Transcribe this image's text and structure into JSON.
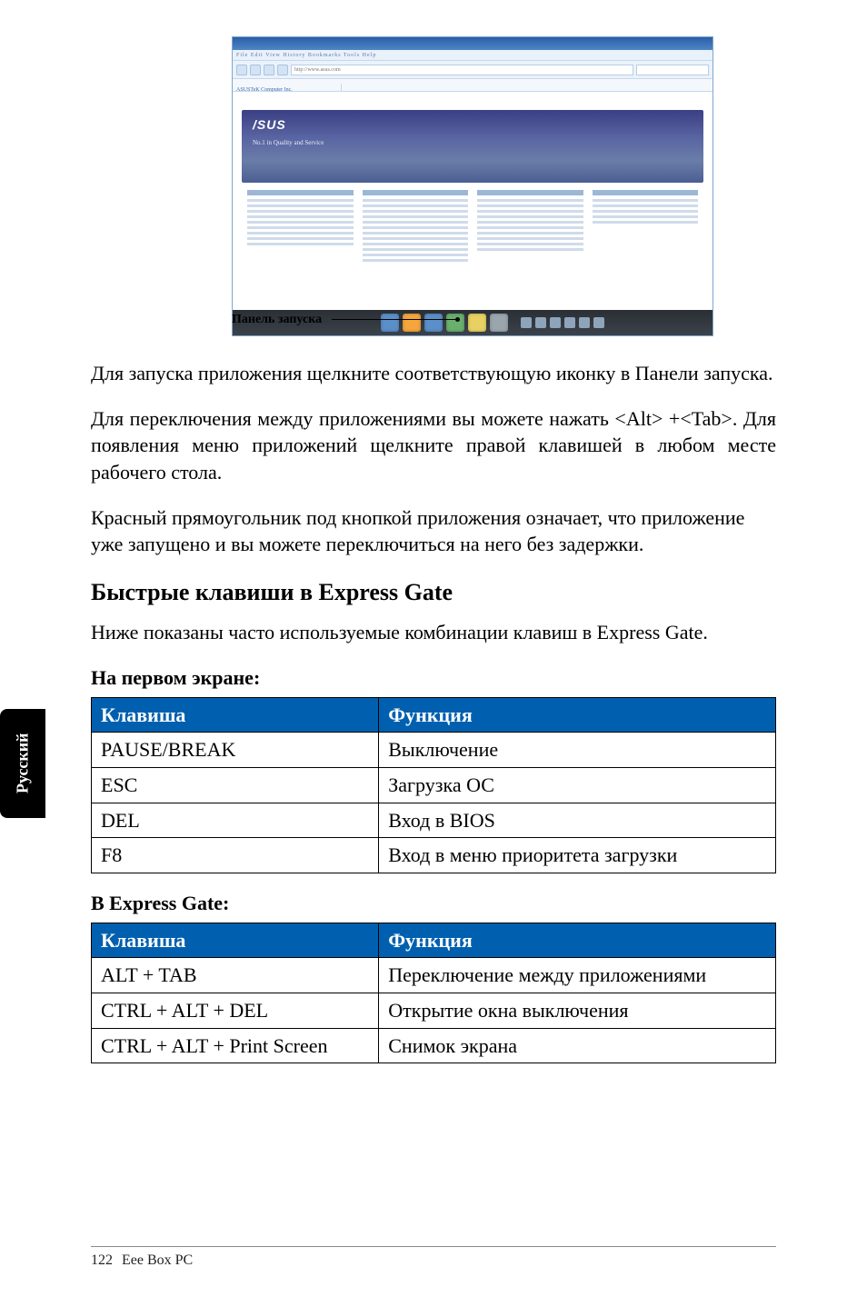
{
  "sideTab": "Русский",
  "screenshot": {
    "calloutLabel": "Панель запуска",
    "logo": "/SUS",
    "subtitle": "No.1 in Quality and Service",
    "menuText": "File Edit View History Bookmarks Tools Help",
    "url": "http://www.asus.com",
    "tab": "ASUSTeK Computer Inc."
  },
  "paragraphs": {
    "p1": "Для запуска приложения щелкните соответствующую иконку в Панели запуска.",
    "p2": "Для переключения между приложениями вы можете нажать <Alt> +<Tab>. Для появления меню приложений щелкните правой клавишей в любом месте рабочего стола.",
    "p3": "Красный прямоугольник под кнопкой приложения означает, что приложение уже запущено и вы можете переключиться на него без задержки."
  },
  "sectionTitle": "Быстрые клавиши в Express Gate",
  "sectionIntro": "Ниже показаны часто используемые комбинации клавиш в Express Gate.",
  "table1": {
    "title": "На первом экране:",
    "headers": {
      "key": "Клавиша",
      "func": "Функция"
    },
    "rows": [
      {
        "key": "PAUSE/BREAK",
        "func": "Выключение"
      },
      {
        "key": "ESC",
        "func": "Загрузка ОС"
      },
      {
        "key": "DEL",
        "func": "Вход в BIOS"
      },
      {
        "key": "F8",
        "func": "Вход в меню приоритета загрузки"
      }
    ]
  },
  "table2": {
    "title": "В Express Gate:",
    "headers": {
      "key": "Клавиша",
      "func": "Функция"
    },
    "rows": [
      {
        "key": "ALT + TAB",
        "func": "Переключение между приложениями"
      },
      {
        "key": "CTRL + ALT + DEL",
        "func": "Открытие окна выключения"
      },
      {
        "key": "CTRL + ALT + Print Screen",
        "func": "Снимок экрана"
      }
    ]
  },
  "footer": {
    "pageNumber": "122",
    "bookTitle": "Eee Box PC"
  }
}
